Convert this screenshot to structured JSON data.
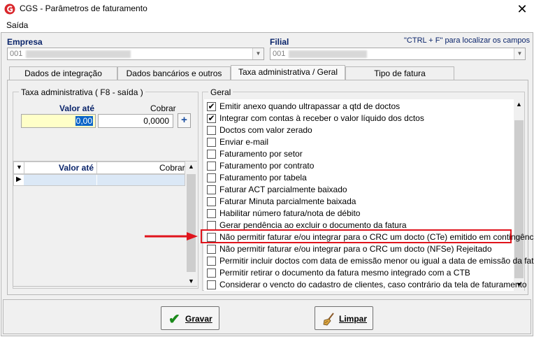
{
  "window": {
    "title": "CGS - Parâmetros de faturamento",
    "close_label": "✕"
  },
  "menu": {
    "items": [
      "Saída"
    ]
  },
  "header": {
    "empresa_label": "Empresa",
    "empresa_value": "001",
    "filial_label": "Filial",
    "filial_value": "001",
    "hint": "\"CTRL + F\" para localizar os campos"
  },
  "tabs": [
    {
      "label": "Dados de integração",
      "active": false
    },
    {
      "label": "Dados bancários e outros",
      "active": false
    },
    {
      "label": "Taxa administrativa / Geral",
      "active": true
    },
    {
      "label": "Tipo de fatura",
      "active": false
    }
  ],
  "taxa": {
    "group_title": "Taxa administrativa ( F8 - saída )",
    "valor_ate_label": "Valor até",
    "cobrar_label": "Cobrar",
    "valor_ate_value": "0,00",
    "cobrar_value": "0,0000",
    "add_label": "+",
    "grid": {
      "columns": [
        "Valor até",
        "Cobrar"
      ]
    }
  },
  "geral": {
    "group_title": "Geral",
    "options": [
      {
        "label": "Emitir anexo quando ultrapassar a qtd de doctos",
        "checked": true
      },
      {
        "label": "Integrar com contas à receber o valor líquido dos dctos",
        "checked": true
      },
      {
        "label": "Doctos com valor zerado",
        "checked": false
      },
      {
        "label": "Enviar e-mail",
        "checked": false
      },
      {
        "label": "Faturamento por setor",
        "checked": false
      },
      {
        "label": "Faturamento por contrato",
        "checked": false
      },
      {
        "label": "Faturamento por tabela",
        "checked": false
      },
      {
        "label": "Faturar ACT parcialmente baixado",
        "checked": false
      },
      {
        "label": "Faturar Minuta parcialmente baixada",
        "checked": false
      },
      {
        "label": "Habilitar número fatura/nota de débito",
        "checked": false
      },
      {
        "label": "Gerar pendência ao excluir o documento da fatura",
        "checked": false
      },
      {
        "label": "Não permitir faturar e/ou integrar para o CRC um docto (CTe) emitido em contingência",
        "checked": false
      },
      {
        "label": "Não permitir faturar e/ou integrar para o CRC um docto (NFSe) Rejeitado",
        "checked": false
      },
      {
        "label": "Permitir incluir doctos com data de emissão menor ou igual a data de emissão da fatura",
        "checked": false
      },
      {
        "label": "Permitir retirar o documento da fatura mesmo integrado com a CTB",
        "checked": false
      },
      {
        "label": "Considerar o vencto do cadastro de clientes, caso contrário da tela de faturamento",
        "checked": false
      }
    ]
  },
  "buttons": {
    "gravar": "Gravar",
    "limpar": "Limpar"
  },
  "colors": {
    "label_blue": "#0a246a",
    "highlight_red": "#e0141c",
    "input_yellow": "#ffffc8"
  }
}
